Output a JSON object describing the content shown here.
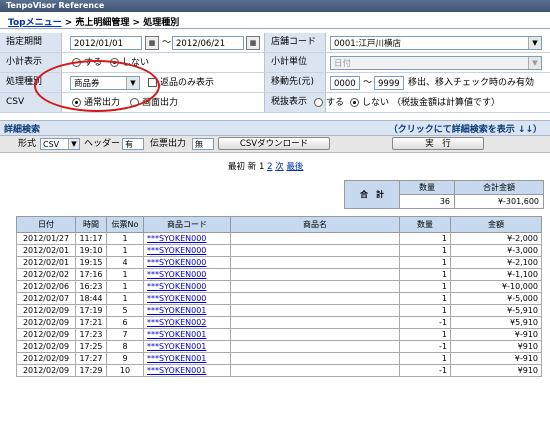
{
  "app": {
    "title": "TenpoVisor Reference"
  },
  "breadcrumb": {
    "home": "Topメニュー",
    "sep1": " > ",
    "level1": "売上明細管理",
    "sep2": " > ",
    "current": "処理種別"
  },
  "form": {
    "period": {
      "label": "指定期間",
      "from": "2012/01/01",
      "tilde": "～",
      "to": "2012/06/21"
    },
    "store": {
      "label": "店舗コード",
      "value": "0001:江戸川横店"
    },
    "subtotal": {
      "label": "小計表示",
      "opt_yes": "する",
      "opt_no": "しない",
      "selected": "no"
    },
    "subtotal_unit": {
      "label": "小計単位",
      "value": "日付"
    },
    "process_type": {
      "label": "処理種別",
      "value": "商品券",
      "check_label": "返品のみ表示"
    },
    "transfer_dest": {
      "label": "移動先(元)",
      "from": "0000",
      "to": "9999",
      "note": "移出、移入チェック時のみ有効"
    },
    "csv": {
      "label": "CSV",
      "opt_normal": "通常出力",
      "opt_screen": "画面出力",
      "selected": "normal"
    },
    "tax_display": {
      "label": "税抜表示",
      "opt_yes": "する",
      "opt_no": "しない",
      "note": "（税抜金額は計算値です）",
      "selected": "no"
    }
  },
  "detail_search": {
    "title": "詳細検索",
    "toggle": "（クリックにて詳細検索を表示 ↓↓）"
  },
  "options": {
    "format_label": "形式",
    "format_value": "CSV",
    "header_label": "ヘッダー",
    "header_value": "有",
    "slip_label": "伝票出力",
    "slip_value": "無",
    "csv_download": "CSVダウンロード",
    "execute": "実　行"
  },
  "pager": {
    "first": "最初",
    "new": "新",
    "p1": "1",
    "p2": "2",
    "next": "次",
    "last": "最後"
  },
  "summary": {
    "label": "合　計",
    "qty_header": "数量",
    "amount_header": "合計金額",
    "qty": "36",
    "amount": "¥-301,600"
  },
  "table": {
    "headers": [
      "日付",
      "時間",
      "伝票No",
      "商品コード",
      "商品名",
      "数量",
      "金額"
    ],
    "rows": [
      [
        "2012/01/27",
        "11:17",
        "1",
        "***SYOKEN000",
        "",
        "1",
        "¥-2,000"
      ],
      [
        "2012/02/01",
        "19:10",
        "1",
        "***SYOKEN000",
        "",
        "1",
        "¥-3,000"
      ],
      [
        "2012/02/01",
        "19:15",
        "4",
        "***SYOKEN000",
        "",
        "1",
        "¥-2,100"
      ],
      [
        "2012/02/02",
        "17:16",
        "1",
        "***SYOKEN000",
        "",
        "1",
        "¥-1,100"
      ],
      [
        "2012/02/06",
        "16:23",
        "1",
        "***SYOKEN000",
        "",
        "1",
        "¥-10,000"
      ],
      [
        "2012/02/07",
        "18:44",
        "1",
        "***SYOKEN000",
        "",
        "1",
        "¥-5,000"
      ],
      [
        "2012/02/09",
        "17:19",
        "5",
        "***SYOKEN001",
        "",
        "1",
        "¥-5,910"
      ],
      [
        "2012/02/09",
        "17:21",
        "6",
        "***SYOKEN002",
        "",
        "-1",
        "¥5,910"
      ],
      [
        "2012/02/09",
        "17:23",
        "7",
        "***SYOKEN001",
        "",
        "1",
        "¥-910"
      ],
      [
        "2012/02/09",
        "17:25",
        "8",
        "***SYOKEN001",
        "",
        "-1",
        "¥910"
      ],
      [
        "2012/02/09",
        "17:27",
        "9",
        "***SYOKEN001",
        "",
        "1",
        "¥-910"
      ],
      [
        "2012/02/09",
        "17:29",
        "10",
        "***SYOKEN001",
        "",
        "-1",
        "¥910"
      ]
    ]
  }
}
